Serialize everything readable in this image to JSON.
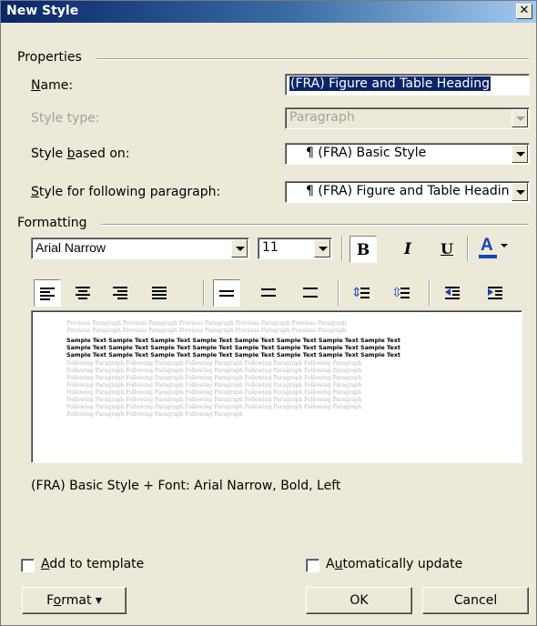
{
  "window": {
    "title": "New Style"
  },
  "properties": {
    "group_label": "Properties",
    "name_label": "Name:",
    "name_mnemonic": "N",
    "name_rest": "ame:",
    "name_value": "(FRA) Figure and Table Heading",
    "style_type_label": "Style type:",
    "style_type_value": "Paragraph",
    "based_on_label_pre": "Style ",
    "based_on_mnemonic": "b",
    "based_on_label_post": "ased on:",
    "based_on_value": "¶ (FRA) Basic Style",
    "following_mnemonic": "S",
    "following_label_post": "tyle for following paragraph:",
    "following_value": "¶ (FRA) Figure and Table Heading"
  },
  "formatting": {
    "group_label": "Formatting",
    "font_name": "Arial Narrow",
    "font_size": "11",
    "bold_label": "B",
    "italic_label": "I",
    "underline_label": "U",
    "font_color_label": "A"
  },
  "preview": {
    "previous_lines": [
      "Previous Paragraph Previous Paragraph Previous Paragraph Previous Paragraph Previous Paragraph",
      "Previous Paragraph Previous Paragraph Previous Paragraph Previous Paragraph Previous Paragraph"
    ],
    "sample_lines": [
      "Sample Text Sample Text Sample Text Sample Text Sample Text Sample Text Sample Text Sample Text",
      "Sample Text Sample Text Sample Text Sample Text Sample Text Sample Text Sample Text Sample Text",
      "Sample Text Sample Text Sample Text Sample Text Sample Text Sample Text Sample Text Sample Text"
    ],
    "following_lines": [
      "Following Paragraph Following Paragraph Following Paragraph Following Paragraph Following Paragraph",
      "Following Paragraph Following Paragraph Following Paragraph Following Paragraph Following Paragraph",
      "Following Paragraph Following Paragraph Following Paragraph Following Paragraph Following Paragraph",
      "Following Paragraph Following Paragraph Following Paragraph Following Paragraph Following Paragraph",
      "Following Paragraph Following Paragraph Following Paragraph Following Paragraph Following Paragraph",
      "Following Paragraph Following Paragraph Following Paragraph Following Paragraph Following Paragraph",
      "Following Paragraph Following Paragraph Following Paragraph Following Paragraph Following Paragraph",
      "Following Paragraph Following Paragraph Following Paragraph"
    ]
  },
  "description": "(FRA) Basic Style + Font: Arial Narrow, Bold, Left",
  "options": {
    "add_to_template_mnemonic": "A",
    "add_to_template_rest": "dd to template",
    "auto_update_pre": "A",
    "auto_update_mnemonic": "u",
    "auto_update_rest": "tomatically update"
  },
  "buttons": {
    "format_pre": "F",
    "format_mnemonic": "o",
    "format_rest": "rmat",
    "format_arrow": "▾",
    "ok": "OK",
    "cancel": "Cancel"
  },
  "colors": {
    "titlebar_start": "#0a246a",
    "titlebar_end": "#a6caf0",
    "face": "#ece9d8",
    "selection": "#0a246a",
    "font_color_bar": "#1a3fbf"
  }
}
